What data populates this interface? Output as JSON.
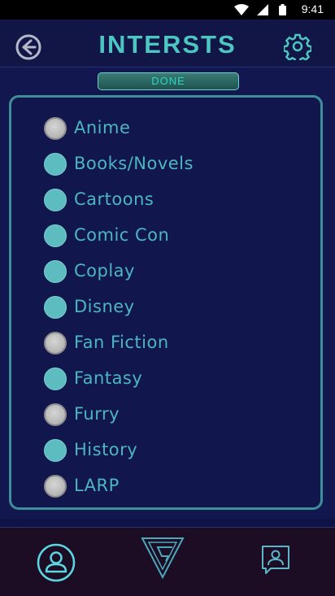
{
  "status_bar": {
    "time": "9:41",
    "wifi_icon": "wifi-icon",
    "signal_icon": "signal-icon",
    "battery_icon": "battery-icon"
  },
  "header": {
    "title": "INTERSTS",
    "back_icon": "back-arrow-icon",
    "settings_icon": "gear-icon"
  },
  "done_label": "DONE",
  "interests": [
    {
      "label": "Anime",
      "selected": false
    },
    {
      "label": "Books/Novels",
      "selected": true
    },
    {
      "label": "Cartoons",
      "selected": true
    },
    {
      "label": "Comic Con",
      "selected": true
    },
    {
      "label": "Coplay",
      "selected": true
    },
    {
      "label": "Disney",
      "selected": true
    },
    {
      "label": "Fan Fiction",
      "selected": false
    },
    {
      "label": "Fantasy",
      "selected": true
    },
    {
      "label": "Furry",
      "selected": false
    },
    {
      "label": "History",
      "selected": true
    },
    {
      "label": "LARP",
      "selected": false
    }
  ],
  "bottom_nav": {
    "profile_icon": "user-icon",
    "logo_icon": "triangle-logo-icon",
    "messages_icon": "contact-card-icon"
  },
  "colors": {
    "accent": "#4dc6c1",
    "background": "#12174f",
    "selected_radio": "#5dbcbf",
    "unselected_radio": "#bdbdbd"
  }
}
